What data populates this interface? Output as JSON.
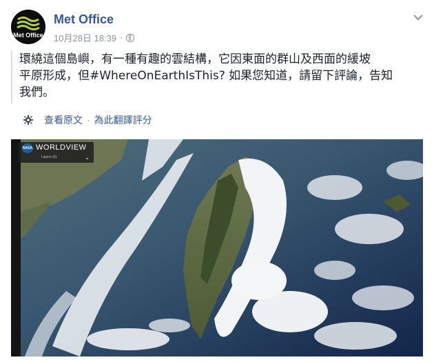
{
  "post": {
    "page_name": "Met Office",
    "avatar_text": "Met Office",
    "timestamp": "10月28日 18:39",
    "separator": "·",
    "audience_icon": "globe-icon",
    "menu_icon": "chevron-down-icon",
    "text_lines": [
      "環繞這個島嶼，有一種有趣的雲結構，它因東面的群山及西面的緩坡",
      "平原形成，但#WhereOnEarthIsThis? 如果您知道，請留下評論，告知",
      "我們。"
    ],
    "see_original": "查看原文",
    "translation_separator": "·",
    "rate_translation": "為此翻譯評分",
    "settings_icon": "gear-icon"
  },
  "image": {
    "badge_logo": "NASA",
    "badge_title": "WORLDVIEW",
    "badge_sub": "Layers (6)",
    "badge_chevron_icon": "chevron-down-icon"
  },
  "colors": {
    "link": "#365899",
    "meta": "#90949c",
    "text": "#1d2129"
  }
}
